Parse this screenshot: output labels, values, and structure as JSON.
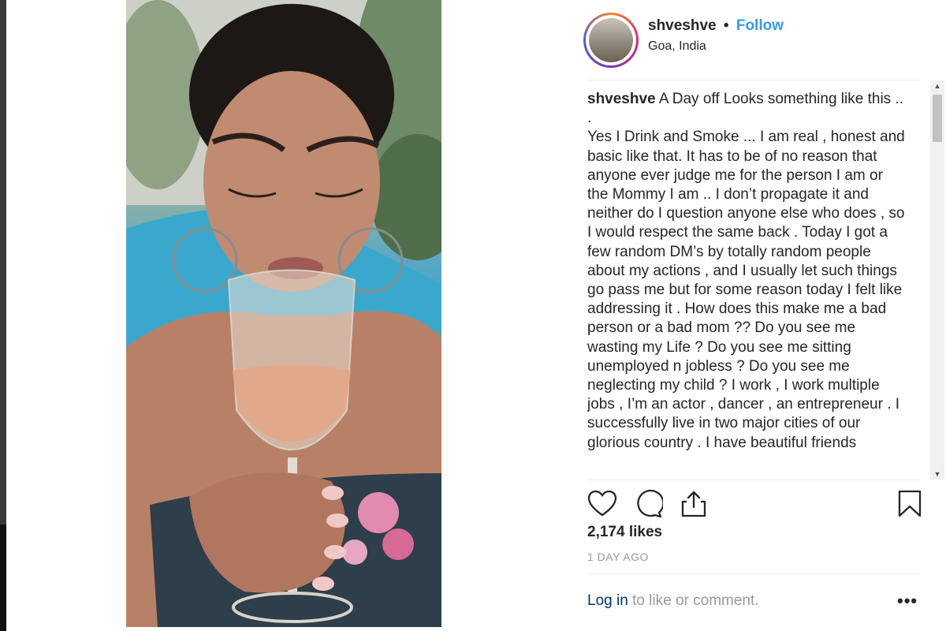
{
  "post": {
    "username": "shveshve",
    "follow_label": "Follow",
    "separator": "•",
    "location": "Goa, India",
    "caption_text": "A Day off Looks something like this ..",
    "caption_dot": ".",
    "caption_body": "Yes I Drink and Smoke ... I am real , honest and basic like that. It has to be of no reason that anyone ever judge me for the person I am or the Mommy I am .. I don’t propagate it and neither do I question anyone else who does , so I would respect the same back . Today I got a few random DM’s by totally random people about my actions , and I usually let such things go pass me but for some reason today I felt like addressing it . How does this make me a bad person or a bad mom ?? Do you see me wasting my Life ? Do you see me sitting unemployed n jobless ? Do you see me neglecting my child ? I work , I work multiple jobs , I’m an actor , dancer , an entrepreneur . I successfully live in two major cities of our glorious country . I have beautiful friends",
    "likes": "2,174 likes",
    "timestamp": "1 DAY AGO",
    "login_link": "Log in",
    "login_rest": "to like or comment.",
    "more_label": "•••"
  },
  "icons": {
    "like": "heart-icon",
    "comment": "comment-icon",
    "share": "share-icon",
    "save": "bookmark-icon"
  },
  "colors": {
    "link_blue": "#3897f0",
    "login_blue": "#003569",
    "muted_gray": "#999999"
  }
}
